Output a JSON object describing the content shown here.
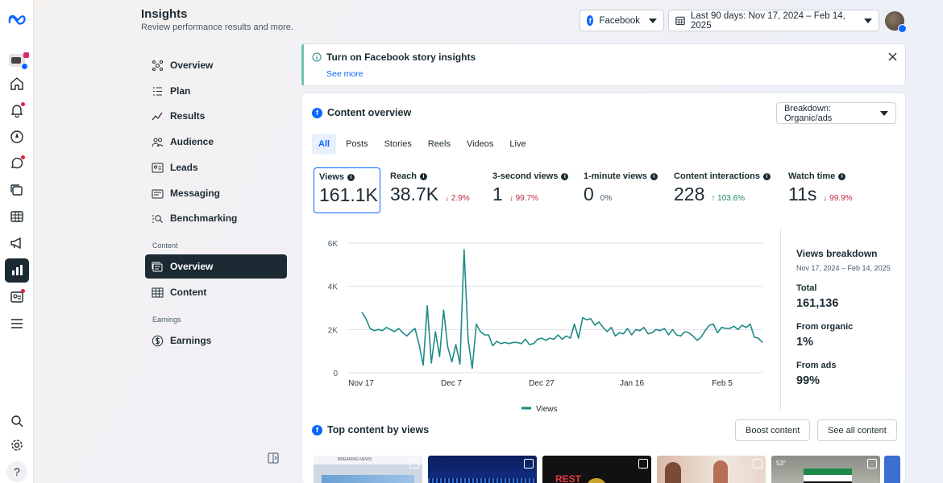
{
  "header": {
    "title": "Insights",
    "subtitle": "Review performance results and more.",
    "platform": "Facebook",
    "date_range": "Last 90 days: Nov 17, 2024 – Feb 14, 2025"
  },
  "nav": {
    "items": [
      {
        "label": "Overview",
        "icon": "overview-icon"
      },
      {
        "label": "Plan",
        "icon": "plan-icon"
      },
      {
        "label": "Results",
        "icon": "results-icon"
      },
      {
        "label": "Audience",
        "icon": "audience-icon"
      },
      {
        "label": "Leads",
        "icon": "leads-icon"
      },
      {
        "label": "Messaging",
        "icon": "messaging-icon"
      },
      {
        "label": "Benchmarking",
        "icon": "benchmarking-icon"
      }
    ],
    "content_section": "Content",
    "content_items": [
      {
        "label": "Overview"
      },
      {
        "label": "Content"
      }
    ],
    "earnings_section": "Earnings",
    "earnings_items": [
      {
        "label": "Earnings"
      }
    ]
  },
  "notice": {
    "title": "Turn on Facebook story insights",
    "link": "See more"
  },
  "content_overview": {
    "title": "Content overview",
    "breakdown": "Breakdown: Organic/ads",
    "tabs": [
      "All",
      "Posts",
      "Stories",
      "Reels",
      "Videos",
      "Live"
    ],
    "active_tab": "All",
    "metrics": [
      {
        "label": "Views",
        "value": "161.1K",
        "delta": "",
        "dir": ""
      },
      {
        "label": "Reach",
        "value": "38.7K",
        "delta": "↓ 2.9%",
        "dir": "down"
      },
      {
        "label": "3-second views",
        "value": "1",
        "delta": "↓ 99.7%",
        "dir": "down"
      },
      {
        "label": "1-minute views",
        "value": "0",
        "delta": "0%",
        "dir": "flat"
      },
      {
        "label": "Content interactions",
        "value": "228",
        "delta": "↑ 103.6%",
        "dir": "up"
      },
      {
        "label": "Watch time",
        "value": "11s",
        "delta": "↓ 99.9%",
        "dir": "down"
      }
    ]
  },
  "chart_data": {
    "type": "line",
    "title": "",
    "xlabel": "",
    "ylabel": "",
    "ylim": [
      0,
      6000
    ],
    "yticks": [
      "0",
      "2K",
      "4K",
      "6K"
    ],
    "xticks": [
      "Nov 17",
      "Dec 7",
      "Dec 27",
      "Jan 16",
      "Feb 5"
    ],
    "legend": "bottom",
    "color": "#1f8a85",
    "series": [
      {
        "name": "Views",
        "x_start": "Nov 17, 2024",
        "values": [
          2800,
          2500,
          2050,
          1950,
          2000,
          1950,
          2100,
          2000,
          1900,
          2050,
          1850,
          1700,
          1900,
          2050,
          1300,
          350,
          3100,
          450,
          1900,
          750,
          2900,
          1200,
          500,
          1300,
          400,
          5700,
          1500,
          200,
          2250,
          1900,
          1750,
          1750,
          1250,
          1450,
          1350,
          1400,
          1350,
          1400,
          1400,
          1350,
          1550,
          1300,
          1350,
          1550,
          1600,
          1500,
          1600,
          1550,
          1750,
          1550,
          1700,
          1600,
          2250,
          1600,
          2550,
          2450,
          2500,
          2200,
          2350,
          2100,
          1900,
          2100,
          1700,
          1850,
          1800,
          2050,
          1750,
          2000,
          1950,
          2100,
          1800,
          1850,
          2000,
          1950,
          2050,
          1750,
          2000,
          1750,
          1700,
          1900,
          1850,
          1700,
          1500,
          1650,
          1950,
          2200,
          2250,
          1850,
          2100,
          2050,
          2050,
          2150,
          2000,
          2200,
          2100,
          2250,
          1650,
          1600,
          1400
        ]
      }
    ]
  },
  "views_breakdown": {
    "title": "Views breakdown",
    "range": "Nov 17, 2024 – Feb 14, 2025",
    "total_label": "Total",
    "total_value": "161,136",
    "organic_label": "From organic",
    "organic_value": "1%",
    "ads_label": "From ads",
    "ads_value": "99%"
  },
  "top_content": {
    "title": "Top content by views",
    "boost": "Boost content",
    "see_all": "See all content",
    "thumbs": [
      {
        "caption": "BREAKING NEWS",
        "bg": "#cfd8e3"
      },
      {
        "caption": "",
        "bg": "#0a1f5c"
      },
      {
        "caption": "REST",
        "bg": "#111111"
      },
      {
        "caption": "",
        "bg": "#d9b9a6"
      },
      {
        "caption": "53°",
        "bg": "#8a8d86"
      }
    ]
  }
}
